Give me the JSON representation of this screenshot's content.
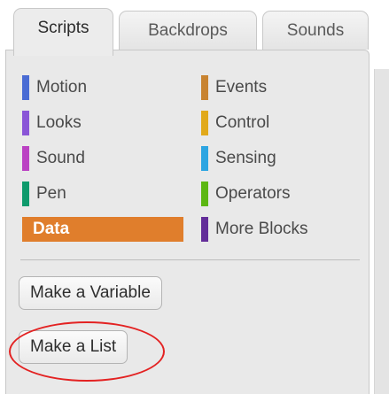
{
  "tabs": [
    {
      "label": "Scripts",
      "active": true
    },
    {
      "label": "Backdrops",
      "active": false
    },
    {
      "label": "Sounds",
      "active": false
    }
  ],
  "categories": {
    "left": [
      {
        "label": "Motion",
        "color": "#4a6cd4"
      },
      {
        "label": "Looks",
        "color": "#8a55d7"
      },
      {
        "label": "Sound",
        "color": "#bb42c3"
      },
      {
        "label": "Pen",
        "color": "#0e9a6c"
      },
      {
        "label": "Data",
        "color": "#ee7d16",
        "selected": true
      }
    ],
    "right": [
      {
        "label": "Events",
        "color": "#c88330"
      },
      {
        "label": "Control",
        "color": "#e1a91a"
      },
      {
        "label": "Sensing",
        "color": "#2ca5e2"
      },
      {
        "label": "Operators",
        "color": "#5cb712"
      },
      {
        "label": "More Blocks",
        "color": "#632d99"
      }
    ]
  },
  "buttons": {
    "make_variable": "Make a Variable",
    "make_list": "Make a List"
  },
  "annotation": {
    "highlight_color": "#e32222"
  }
}
